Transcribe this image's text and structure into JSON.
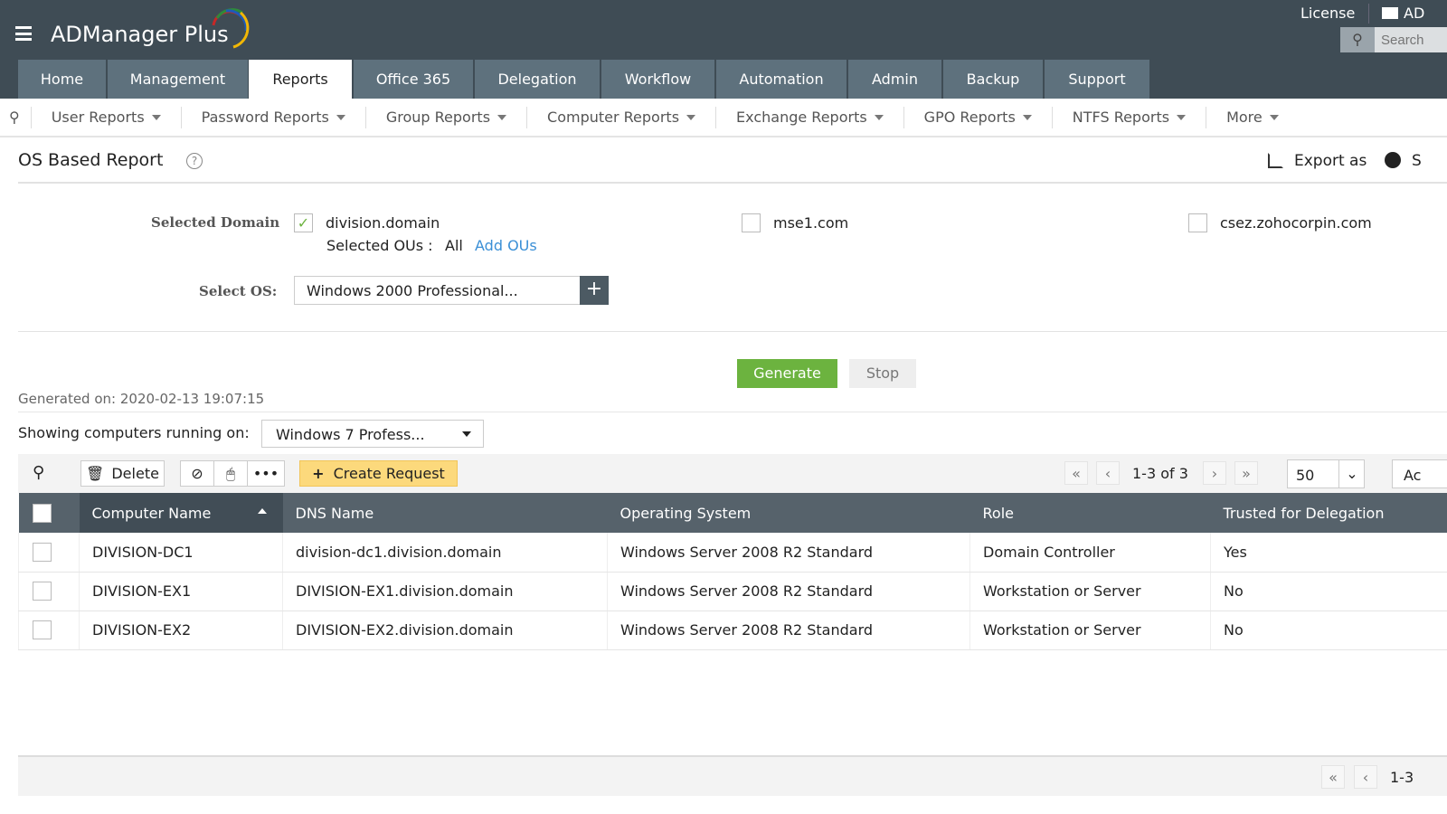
{
  "header": {
    "app_name": "ADManager Plus",
    "license": "License",
    "ad_label": "AD",
    "search_placeholder": "Search"
  },
  "tabs": [
    {
      "label": "Home"
    },
    {
      "label": "Management"
    },
    {
      "label": "Reports"
    },
    {
      "label": "Office 365"
    },
    {
      "label": "Delegation"
    },
    {
      "label": "Workflow"
    },
    {
      "label": "Automation"
    },
    {
      "label": "Admin"
    },
    {
      "label": "Backup"
    },
    {
      "label": "Support"
    }
  ],
  "subnav": [
    "User Reports",
    "Password Reports",
    "Group Reports",
    "Computer Reports",
    "Exchange Reports",
    "GPO Reports",
    "NTFS Reports",
    "More"
  ],
  "page": {
    "title": "OS Based Report",
    "export": "Export as",
    "schedule": "S"
  },
  "form": {
    "domain_label": "Selected Domain",
    "domains": [
      {
        "name": "division.domain",
        "checked": true
      },
      {
        "name": "mse1.com",
        "checked": false
      },
      {
        "name": "csez.zohocorpin.com",
        "checked": false
      }
    ],
    "ous_label": "Selected OUs :",
    "ous_value": "All",
    "add_ous": "Add OUs",
    "os_label": "Select OS:",
    "os_value": "Windows 2000 Professional...",
    "generate": "Generate",
    "stop": "Stop"
  },
  "result": {
    "generated_on": "Generated on: 2020-02-13 19:07:15",
    "showing_label": "Showing computers running on:",
    "showing_value": "Windows 7 Profess..."
  },
  "toolbar": {
    "delete": "Delete",
    "create_request": "Create Request",
    "page_info": "1-3 of 3",
    "page_size": "50",
    "add": "Ac"
  },
  "table": {
    "columns": [
      "Computer Name",
      "DNS Name",
      "Operating System",
      "Role",
      "Trusted for Delegation"
    ],
    "rows": [
      [
        "DIVISION-DC1",
        "division-dc1.division.domain",
        "Windows Server 2008 R2 Standard",
        "Domain Controller",
        "Yes"
      ],
      [
        "DIVISION-EX1",
        "DIVISION-EX1.division.domain",
        "Windows Server 2008 R2 Standard",
        "Workstation or Server",
        "No"
      ],
      [
        "DIVISION-EX2",
        "DIVISION-EX2.division.domain",
        "Windows Server 2008 R2 Standard",
        "Workstation or Server",
        "No"
      ]
    ]
  },
  "footer": {
    "page_info": "1-3"
  },
  "colors": {
    "header": "#3f4c55",
    "tab": "#5e717d",
    "generate": "#6cb33f",
    "create": "#fcd97c",
    "link": "#3a8fd6"
  }
}
